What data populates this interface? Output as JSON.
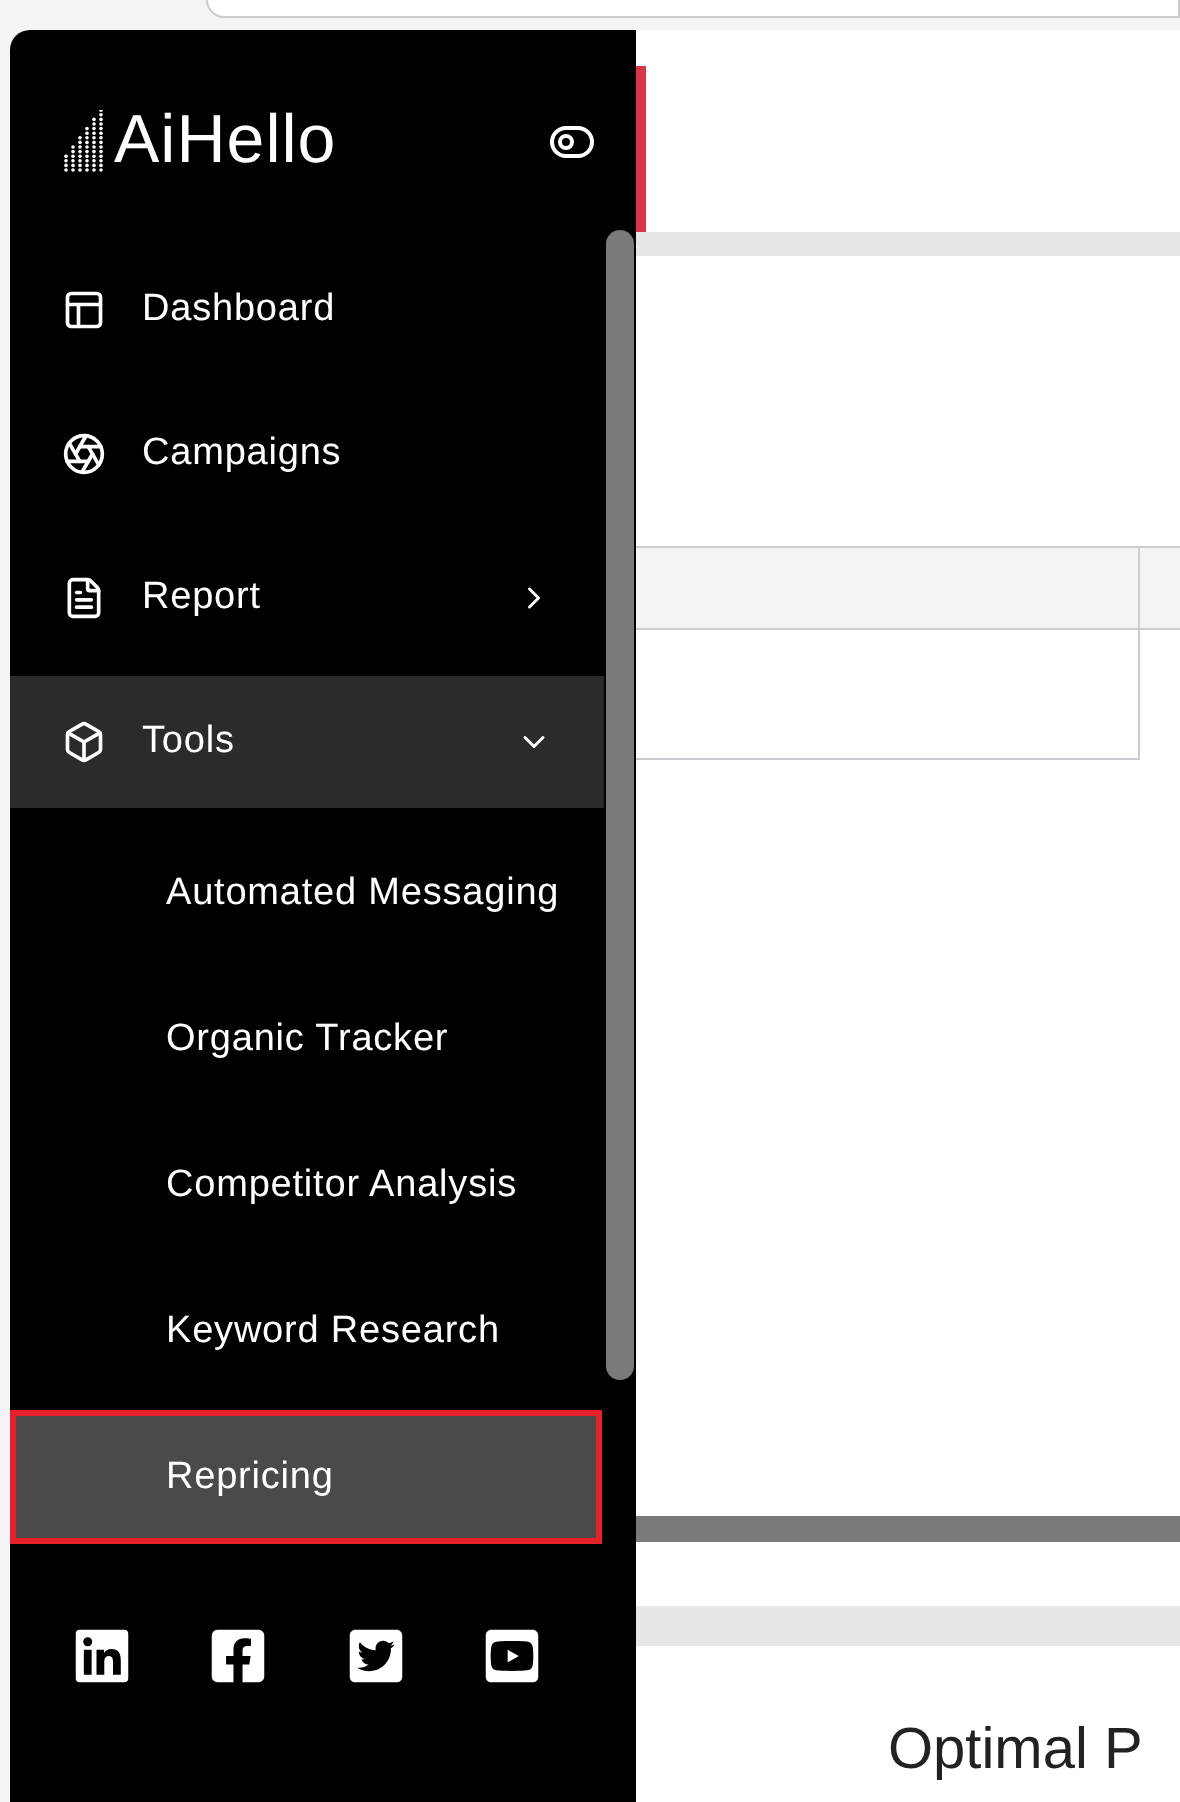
{
  "sidebar": {
    "logo": "AiHello",
    "items": [
      {
        "label": "Dashboard",
        "kind": "link"
      },
      {
        "label": "Campaigns",
        "kind": "link"
      },
      {
        "label": "Report",
        "kind": "group",
        "expanded": false
      },
      {
        "label": "Tools",
        "kind": "group",
        "expanded": true,
        "children": [
          {
            "label": "Automated Messaging",
            "selected": false
          },
          {
            "label": "Organic Tracker",
            "selected": false
          },
          {
            "label": "Competitor Analysis",
            "selected": false
          },
          {
            "label": "Keyword Research",
            "selected": false
          },
          {
            "label": "Repricing",
            "selected": true
          }
        ]
      }
    ]
  },
  "main": {
    "heading": "Optimal P"
  }
}
